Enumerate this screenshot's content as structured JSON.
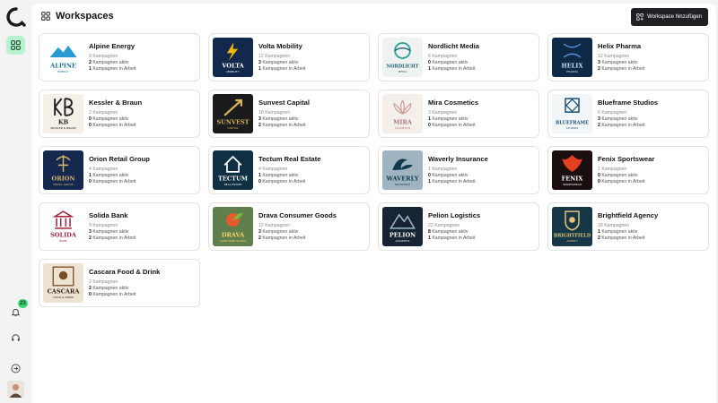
{
  "page": {
    "title": "Workspaces"
  },
  "toolbar": {
    "add_label": "Workspace hinzufügen"
  },
  "rail": {
    "notification_count": "23"
  },
  "workspaces": [
    {
      "name": "Alpine Energy",
      "campaigns": "9 Kampagnen",
      "active_count": "2",
      "active_label": "Kampagnen aktiv",
      "work_count": "1",
      "work_label": "Kampagnen in Arbeit",
      "logo_text": "ALPINE",
      "logo_sub": "ENERGY"
    },
    {
      "name": "Volta Mobility",
      "campaigns": "12 Kampagnen",
      "active_count": "3",
      "active_label": "Kampagnen aktiv",
      "work_count": "1",
      "work_label": "Kampagnen in Arbeit",
      "logo_text": "VOLTA",
      "logo_sub": "MOBILITY"
    },
    {
      "name": "Nordlicht Media",
      "campaigns": "6 Kampagnen",
      "active_count": "0",
      "active_label": "Kampagnen aktiv",
      "work_count": "1",
      "work_label": "Kampagnen in Arbeit",
      "logo_text": "NORDLICHT",
      "logo_sub": "MEDIA"
    },
    {
      "name": "Helix Pharma",
      "campaigns": "12 Kampagnen",
      "active_count": "3",
      "active_label": "Kampagnen aktiv",
      "work_count": "2",
      "work_label": "Kampagnen in Arbeit",
      "logo_text": "HELIX",
      "logo_sub": "PHARMA"
    },
    {
      "name": "Kessler & Braun",
      "campaigns": "2 Kampagnen",
      "active_count": "0",
      "active_label": "Kampagnen aktiv",
      "work_count": "0",
      "work_label": "Kampagnen in Arbeit",
      "logo_text": "KB",
      "logo_sub": "KESSLER & BRAUN"
    },
    {
      "name": "Sunvest Capital",
      "campaigns": "18 Kampagnen",
      "active_count": "3",
      "active_label": "Kampagnen aktiv",
      "work_count": "2",
      "work_label": "Kampagnen in Arbeit",
      "logo_text": "SUNVEST",
      "logo_sub": "CAPITAL"
    },
    {
      "name": "Mira Cosmetics",
      "campaigns": "3 Kampagnen",
      "active_count": "1",
      "active_label": "Kampagnen aktiv",
      "work_count": "0",
      "work_label": "Kampagnen in Arbeit",
      "logo_text": "MIRA",
      "logo_sub": "COSMETICS"
    },
    {
      "name": "Blueframe Studios",
      "campaigns": "6 Kampagnen",
      "active_count": "3",
      "active_label": "Kampagnen aktiv",
      "work_count": "2",
      "work_label": "Kampagnen in Arbeit",
      "logo_text": "BLUEFRAME",
      "logo_sub": "STUDIOS"
    },
    {
      "name": "Orion Retail Group",
      "campaigns": "4 Kampagnen",
      "active_count": "1",
      "active_label": "Kampagnen aktiv",
      "work_count": "0",
      "work_label": "Kampagnen in Arbeit",
      "logo_text": "ORION",
      "logo_sub": "RETAIL GROUP"
    },
    {
      "name": "Tectum Real Estate",
      "campaigns": "4 Kampagnen",
      "active_count": "1",
      "active_label": "Kampagnen aktiv",
      "work_count": "0",
      "work_label": "Kampagnen in Arbeit",
      "logo_text": "TECTUM",
      "logo_sub": "REAL ESTATE"
    },
    {
      "name": "Waverly Insurance",
      "campaigns": "1 Kampagnen",
      "active_count": "0",
      "active_label": "Kampagnen aktiv",
      "work_count": "1",
      "work_label": "Kampagnen in Arbeit",
      "logo_text": "WAVERLY",
      "logo_sub": "INSURANCE"
    },
    {
      "name": "Fenix Sportswear",
      "campaigns": "1 Kampagnen",
      "active_count": "0",
      "active_label": "Kampagnen aktiv",
      "work_count": "0",
      "work_label": "Kampagnen in Arbeit",
      "logo_text": "FENIX",
      "logo_sub": "SPORTSWEAR"
    },
    {
      "name": "Solida Bank",
      "campaigns": "9 Kampagnen",
      "active_count": "3",
      "active_label": "Kampagnen aktiv",
      "work_count": "2",
      "work_label": "Kampagnen in Arbeit",
      "logo_text": "SOLIDA",
      "logo_sub": "BANK"
    },
    {
      "name": "Drava Consumer Goods",
      "campaigns": "12 Kampagnen",
      "active_count": "3",
      "active_label": "Kampagnen aktiv",
      "work_count": "2",
      "work_label": "Kampagnen in Arbeit",
      "logo_text": "DRAVA",
      "logo_sub": "CONSUMER GOODS"
    },
    {
      "name": "Pelion Logistics",
      "campaigns": "22 Kampagnen",
      "active_count": "8",
      "active_label": "Kampagnen aktiv",
      "work_count": "1",
      "work_label": "Kampagnen in Arbeit",
      "logo_text": "PELION",
      "logo_sub": "LOGISTICS"
    },
    {
      "name": "Brightfield Agency",
      "campaigns": "18 Kampagnen",
      "active_count": "1",
      "active_label": "Kampagnen aktiv",
      "work_count": "2",
      "work_label": "Kampagnen in Arbeit",
      "logo_text": "BRIGHTFIELD",
      "logo_sub": "AGENCY"
    },
    {
      "name": "Cascara Food & Drink",
      "campaigns": "2 Kampagnen",
      "active_count": "2",
      "active_label": "Kampagnen aktiv",
      "work_count": "0",
      "work_label": "Kampagnen in Arbeit",
      "logo_text": "CASCARA",
      "logo_sub": "FOOD & DRINK"
    }
  ],
  "colors": {
    "accent": "#b8f2cf",
    "badge": "#39d474",
    "button_bg": "#1f2124"
  }
}
